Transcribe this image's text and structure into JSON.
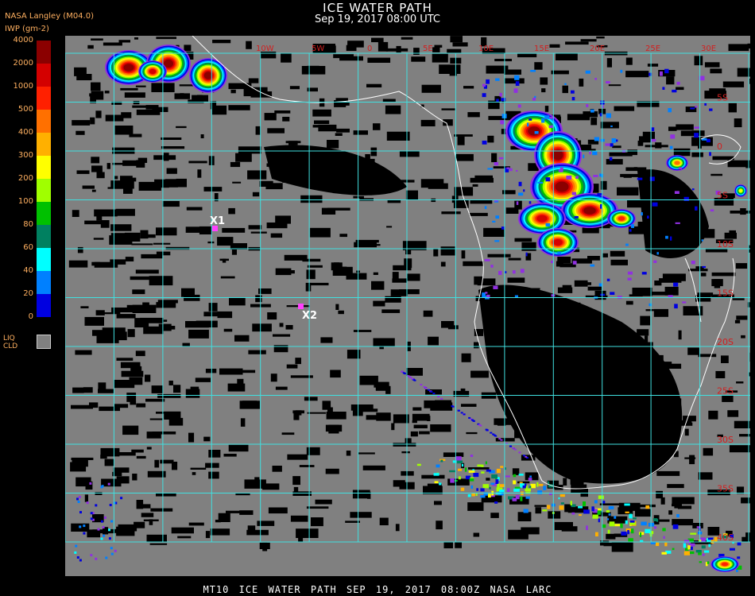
{
  "header": {
    "title": "ICE WATER PATH",
    "subtitle": "Sep 19, 2017 08:00 UTC",
    "source": "NASA Langley (M04.0)",
    "units": "IWP (gm-2)"
  },
  "legend": {
    "ticks": [
      "4000",
      "2000",
      "1000",
      "500",
      "400",
      "300",
      "200",
      "100",
      "80",
      "60",
      "40",
      "20",
      "0"
    ],
    "colors": [
      "#8b0000",
      "#d40000",
      "#ff2000",
      "#ff7000",
      "#ffb000",
      "#ffff00",
      "#a0ff00",
      "#00c000",
      "#008060",
      "#00ffff",
      "#0080ff",
      "#0000e0",
      "#9030e0"
    ],
    "liquid_label_1": "LIQ",
    "liquid_label_2": "CLD",
    "liquid_color": "#808080"
  },
  "map": {
    "background_cloud_color": "#808080",
    "clear_color": "#000000",
    "grid_color": "#40e0e0",
    "coast_color": "#ffffff",
    "lat_labels": [
      "5S",
      "0",
      "5S",
      "10S",
      "15S",
      "20S",
      "25S",
      "30S",
      "35S",
      "40S"
    ],
    "lon_labels": [
      "10W",
      "5W",
      "0",
      "5E",
      "10E",
      "15E",
      "20E",
      "25E",
      "30E"
    ],
    "markers": [
      {
        "label": "X1",
        "color": "#ff40ff"
      },
      {
        "label": "X2",
        "color": "#ff40ff"
      }
    ]
  },
  "footer": {
    "text": "MT10  ICE WATER PATH  SEP 19, 2017 08:00Z  NASA LARC"
  }
}
